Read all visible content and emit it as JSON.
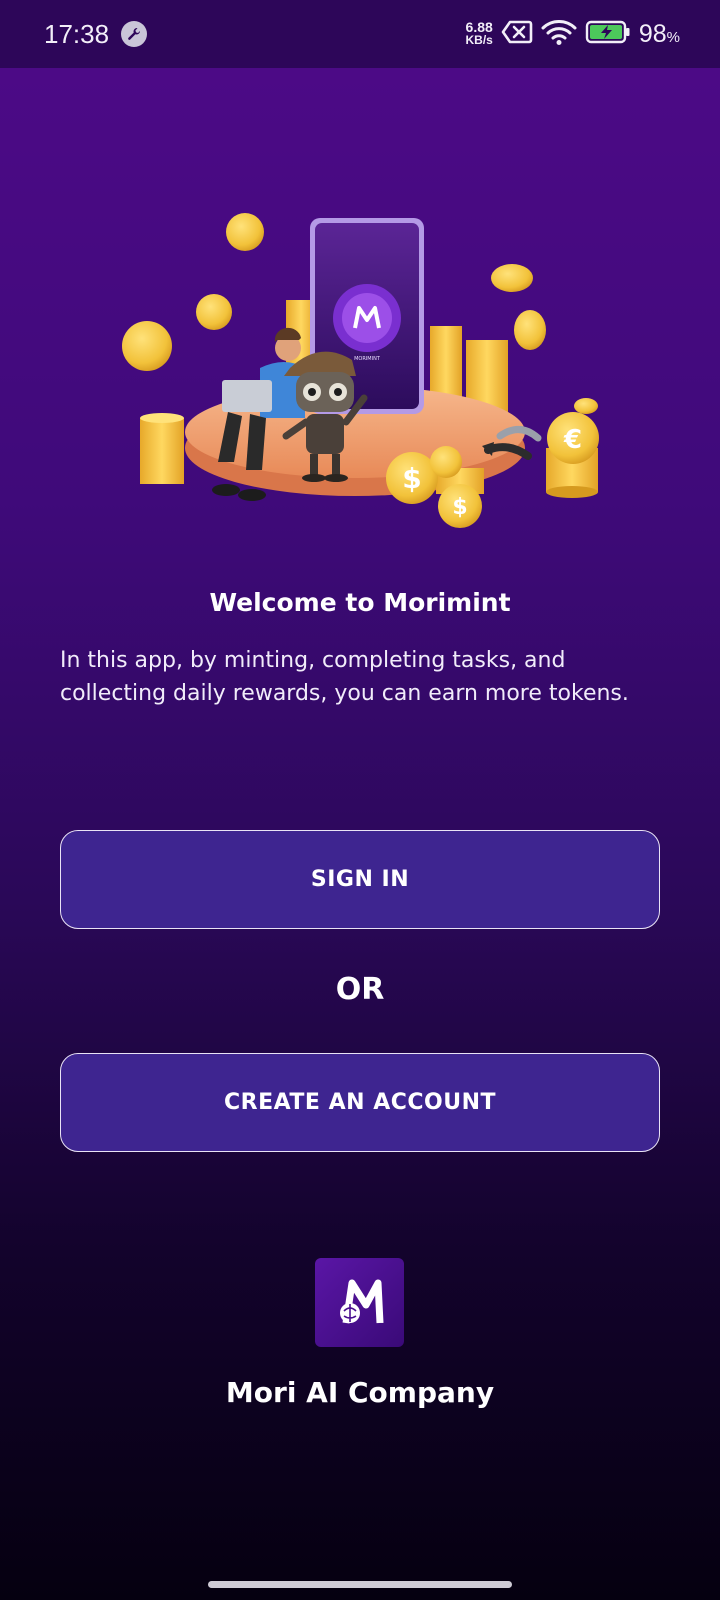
{
  "status_bar": {
    "time": "17:38",
    "net_speed_value": "6.88",
    "net_speed_unit": "KB/s",
    "battery_percent": "98",
    "battery_unit": "%",
    "icons": [
      "wrench-icon",
      "data-off-icon",
      "wifi-icon",
      "battery-charging-icon"
    ]
  },
  "hero": {
    "phone_brand": "MORIMINT"
  },
  "welcome": {
    "title": "Welcome to Morimint",
    "body": "In this app, by minting, completing tasks, and collecting daily rewards, you can earn more tokens."
  },
  "actions": {
    "sign_in_label": "SIGN IN",
    "or_label": "OR",
    "create_account_label": "CREATE AN ACCOUNT"
  },
  "footer": {
    "company_name": "Mori AI Company"
  },
  "colors": {
    "background_top": "#4e0a88",
    "background_bottom": "#050010",
    "status_bar": "#2d0659",
    "button_fill": "#3e2590",
    "button_border": "#e9e3f6",
    "coin_gold": "#f2c23a"
  }
}
